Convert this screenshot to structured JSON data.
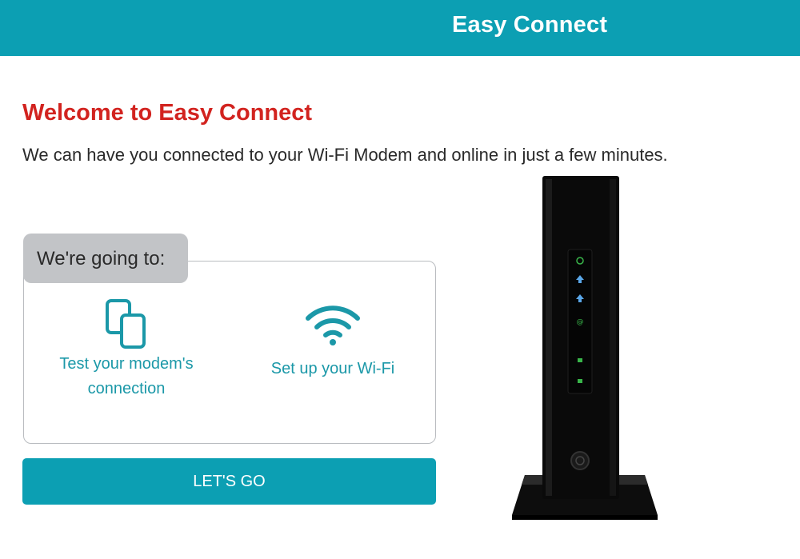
{
  "header": {
    "title": "Easy Connect"
  },
  "welcome": {
    "title": "Welcome to Easy Connect",
    "subtitle": "We can have you connected to your Wi-Fi Modem and online in just a few minutes."
  },
  "steps": {
    "heading": "We're going to:",
    "items": [
      {
        "label_line1": "Test your modem's",
        "label_line2": "connection",
        "icon": "copy-icon"
      },
      {
        "label_line1": "Set up your Wi-Fi",
        "icon": "wifi-icon"
      }
    ]
  },
  "actions": {
    "go_label": "LET'S GO"
  },
  "colors": {
    "brand": "#0c9fb3",
    "welcome_red": "#d2231f",
    "step_text": "#1b98a8"
  },
  "modem_image": {
    "icon": "modem-image"
  }
}
